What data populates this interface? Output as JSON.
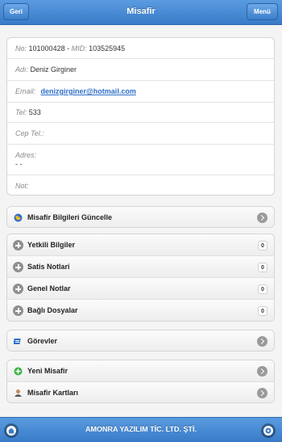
{
  "header": {
    "title": "Misafir",
    "back_label": "Geri",
    "menu_label": "Menü"
  },
  "guest": {
    "no_label": "No:",
    "no_value": "101000428",
    "mid_label": "MID:",
    "mid_value": "103525945",
    "name_label": "Adı:",
    "name_value": "Deniz Girginer",
    "email_label": "Email:",
    "email_value": "denizgirginer@hotmail.com",
    "tel_label": "Tel:",
    "tel_value": "533",
    "mobile_label": "Cep Tel.:",
    "mobile_value": "",
    "address_label": "Adres:",
    "address_value": "- -",
    "note_label": "Not:",
    "note_value": ""
  },
  "update_item": {
    "label": "Misafir Bilgileri Güncelle"
  },
  "sections": [
    {
      "label": "Yetkili Bilgiler",
      "count": "0"
    },
    {
      "label": "Satis Notlari",
      "count": "0"
    },
    {
      "label": "Genel Notlar",
      "count": "0"
    },
    {
      "label": "Bağlı Dosyalar",
      "count": "0"
    }
  ],
  "tasks_item": {
    "label": "Görevler"
  },
  "actions": [
    {
      "label": "Yeni Misafir"
    },
    {
      "label": "Misafir Kartları"
    }
  ],
  "footer": {
    "title": "AMONRA YAZILIM TİC. LTD. ŞTİ."
  },
  "colors": {
    "header": "#3a7bc8",
    "link": "#2f6fc9"
  }
}
